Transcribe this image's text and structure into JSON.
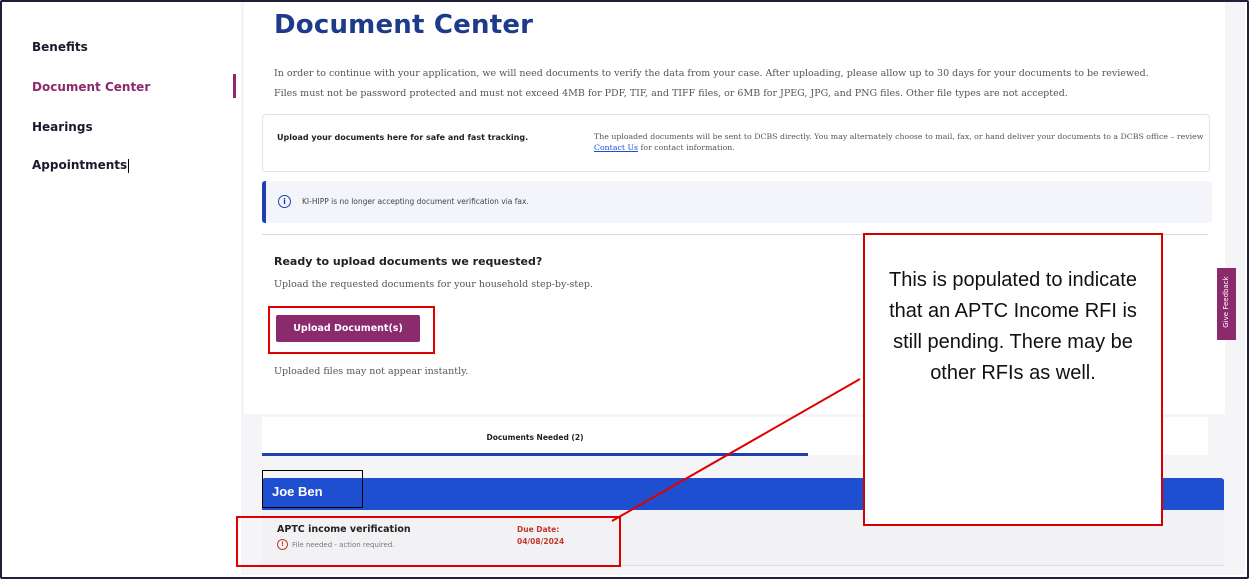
{
  "sidebar": {
    "items": [
      {
        "label": "Benefits"
      },
      {
        "label": "Document Center"
      },
      {
        "label": "Hearings"
      },
      {
        "label": "Appointments"
      }
    ]
  },
  "page": {
    "title": "Document Center",
    "intro_line1": "In order to continue with your application, we will need documents to verify the data from your case. After uploading, please allow up to 30 days for your documents to be reviewed.",
    "intro_line2": "Files must not be password protected and must not exceed 4MB for PDF, TIF, and TIFF files, or 6MB for JPEG, JPG, and PNG files. Other file types are not accepted."
  },
  "info_card": {
    "left_text": "Upload your documents here for safe and fast tracking.",
    "right_text_before_link": "The uploaded documents will be sent to DCBS directly. You may alternately choose to mail, fax, or hand deliver your documents to a DCBS office – review ",
    "link_text": "Contact Us",
    "right_text_after_link": " for contact information."
  },
  "alert": {
    "icon": "info-icon",
    "text": "KI-HIPP is no longer accepting document verification via fax."
  },
  "upload_section": {
    "heading": "Ready to upload documents we requested?",
    "subtext": "Upload the requested documents for your household step-by-step.",
    "button_label": "Upload Document(s)",
    "note": "Uploaded files may not appear instantly."
  },
  "tabs": [
    {
      "label": "Documents Needed (2)",
      "active": true
    }
  ],
  "feedback_tab": {
    "label": "Give Feedback"
  },
  "household": {
    "person_name": "Joe Ben",
    "documents": [
      {
        "title": "APTC income verification",
        "status": "File needed - action required.",
        "status_icon": "alert-circle-icon",
        "due_label": "Due Date:",
        "due_value": "04/08/2024"
      }
    ]
  },
  "annotation": {
    "callout_text": "This is populated to indicate that an APTC Income RFI is still pending.  There may be other RFIs as well."
  },
  "colors": {
    "brand_purple": "#8b2a6d",
    "title_blue": "#1e3a8a",
    "bar_blue": "#1f4fd1",
    "annotation_red": "#e00000"
  }
}
